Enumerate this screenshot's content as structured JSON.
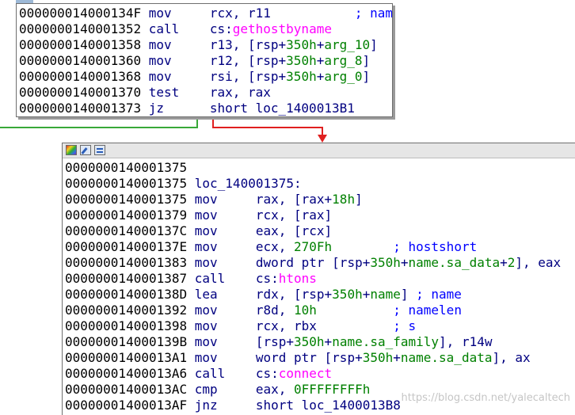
{
  "top_block": {
    "lines": [
      {
        "addr": "000000014000134F",
        "mnem": "mov",
        "parts": [
          {
            "t": "rcx, r11           ",
            "c": "op"
          },
          {
            "t": "; name",
            "c": "cmt"
          }
        ]
      },
      {
        "addr": "0000000140001352",
        "mnem": "call",
        "parts": [
          {
            "t": "cs:",
            "c": "op"
          },
          {
            "t": "gethostbyname",
            "c": "imp"
          }
        ]
      },
      {
        "addr": "0000000140001358",
        "mnem": "mov",
        "parts": [
          {
            "t": "r13, [rsp+",
            "c": "op"
          },
          {
            "t": "350h",
            "c": "grn"
          },
          {
            "t": "+",
            "c": "op"
          },
          {
            "t": "arg_10",
            "c": "grn"
          },
          {
            "t": "]",
            "c": "op"
          }
        ]
      },
      {
        "addr": "0000000140001360",
        "mnem": "mov",
        "parts": [
          {
            "t": "r12, [rsp+",
            "c": "op"
          },
          {
            "t": "350h",
            "c": "grn"
          },
          {
            "t": "+",
            "c": "op"
          },
          {
            "t": "arg_8",
            "c": "grn"
          },
          {
            "t": "]",
            "c": "op"
          }
        ]
      },
      {
        "addr": "0000000140001368",
        "mnem": "mov",
        "parts": [
          {
            "t": "rsi, [rsp+",
            "c": "op"
          },
          {
            "t": "350h",
            "c": "grn"
          },
          {
            "t": "+",
            "c": "op"
          },
          {
            "t": "arg_0",
            "c": "grn"
          },
          {
            "t": "]",
            "c": "op"
          }
        ]
      },
      {
        "addr": "0000000140001370",
        "mnem": "test",
        "parts": [
          {
            "t": "rax, rax",
            "c": "op"
          }
        ]
      },
      {
        "addr": "0000000140001373",
        "mnem": "jz",
        "parts": [
          {
            "t": "short loc_1400013B1",
            "c": "op"
          }
        ]
      }
    ]
  },
  "bottom_block": {
    "lines": [
      {
        "addr": "0000000140001375",
        "mnem": "",
        "parts": []
      },
      {
        "addr": "0000000140001375",
        "label": "loc_140001375:",
        "mnem": "",
        "parts": []
      },
      {
        "addr": "0000000140001375",
        "mnem": "mov",
        "parts": [
          {
            "t": "rax, [rax+",
            "c": "op"
          },
          {
            "t": "18h",
            "c": "grn"
          },
          {
            "t": "]",
            "c": "op"
          }
        ]
      },
      {
        "addr": "0000000140001379",
        "mnem": "mov",
        "parts": [
          {
            "t": "rcx, [rax]",
            "c": "op"
          }
        ]
      },
      {
        "addr": "000000014000137C",
        "mnem": "mov",
        "parts": [
          {
            "t": "eax, [rcx]",
            "c": "op"
          }
        ]
      },
      {
        "addr": "000000014000137E",
        "mnem": "mov",
        "parts": [
          {
            "t": "ecx, ",
            "c": "op"
          },
          {
            "t": "270Fh",
            "c": "grn"
          },
          {
            "t": "        ",
            "c": "op"
          },
          {
            "t": "; hostshort",
            "c": "cmt"
          }
        ]
      },
      {
        "addr": "0000000140001383",
        "mnem": "mov",
        "parts": [
          {
            "t": "dword ptr [rsp+",
            "c": "op"
          },
          {
            "t": "350h",
            "c": "grn"
          },
          {
            "t": "+",
            "c": "op"
          },
          {
            "t": "name.sa_data",
            "c": "grn"
          },
          {
            "t": "+",
            "c": "op"
          },
          {
            "t": "2",
            "c": "grn"
          },
          {
            "t": "], eax",
            "c": "op"
          }
        ]
      },
      {
        "addr": "0000000140001387",
        "mnem": "call",
        "parts": [
          {
            "t": "cs:",
            "c": "op"
          },
          {
            "t": "htons",
            "c": "imp"
          }
        ]
      },
      {
        "addr": "000000014000138D",
        "mnem": "lea",
        "parts": [
          {
            "t": "rdx, [rsp+",
            "c": "op"
          },
          {
            "t": "350h",
            "c": "grn"
          },
          {
            "t": "+",
            "c": "op"
          },
          {
            "t": "name",
            "c": "grn"
          },
          {
            "t": "] ",
            "c": "op"
          },
          {
            "t": "; name",
            "c": "cmt"
          }
        ]
      },
      {
        "addr": "0000000140001392",
        "mnem": "mov",
        "parts": [
          {
            "t": "r8d, ",
            "c": "op"
          },
          {
            "t": "10h",
            "c": "grn"
          },
          {
            "t": "          ",
            "c": "op"
          },
          {
            "t": "; namelen",
            "c": "cmt"
          }
        ]
      },
      {
        "addr": "0000000140001398",
        "mnem": "mov",
        "parts": [
          {
            "t": "rcx, rbx          ",
            "c": "op"
          },
          {
            "t": "; s",
            "c": "cmt"
          }
        ]
      },
      {
        "addr": "000000014000139B",
        "mnem": "mov",
        "parts": [
          {
            "t": "[rsp+",
            "c": "op"
          },
          {
            "t": "350h",
            "c": "grn"
          },
          {
            "t": "+",
            "c": "op"
          },
          {
            "t": "name.sa_family",
            "c": "grn"
          },
          {
            "t": "], r14w",
            "c": "op"
          }
        ]
      },
      {
        "addr": "00000001400013A1",
        "mnem": "mov",
        "parts": [
          {
            "t": "word ptr [rsp+",
            "c": "op"
          },
          {
            "t": "350h",
            "c": "grn"
          },
          {
            "t": "+",
            "c": "op"
          },
          {
            "t": "name.sa_data",
            "c": "grn"
          },
          {
            "t": "], ax",
            "c": "op"
          }
        ]
      },
      {
        "addr": "00000001400013A6",
        "mnem": "call",
        "parts": [
          {
            "t": "cs:",
            "c": "op"
          },
          {
            "t": "connect",
            "c": "imp"
          }
        ]
      },
      {
        "addr": "00000001400013AC",
        "mnem": "cmp",
        "parts": [
          {
            "t": "eax, ",
            "c": "op"
          },
          {
            "t": "0FFFFFFFFh",
            "c": "grn"
          }
        ]
      },
      {
        "addr": "00000001400013AF",
        "mnem": "jnz",
        "parts": [
          {
            "t": "short loc_1400013B8",
            "c": "op"
          }
        ]
      }
    ]
  },
  "watermark": "https://blog.csdn.net/yalecaltech",
  "colors": {
    "mnemonic": "#000080",
    "import": "#ff00ff",
    "number": "#008000",
    "comment": "#0000ff",
    "edge_true": "#38a838",
    "edge_false": "#e02020"
  }
}
